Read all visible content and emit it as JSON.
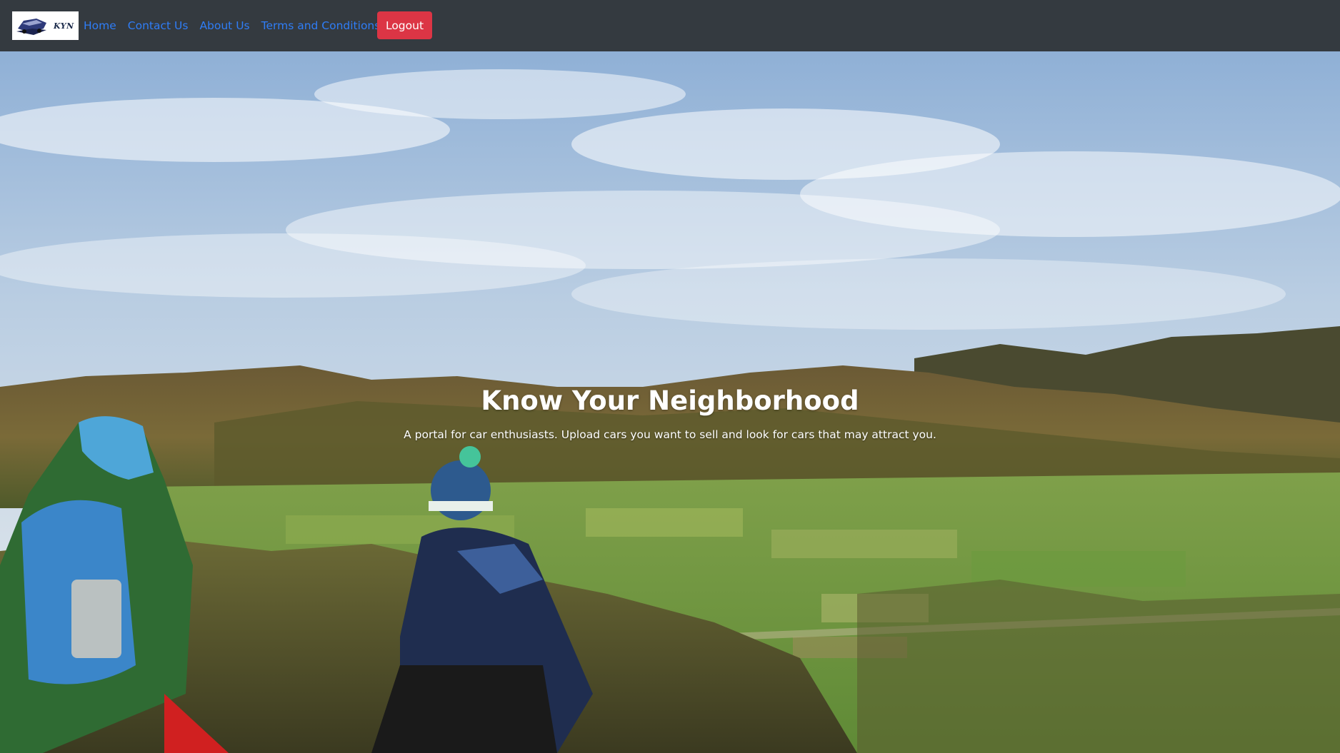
{
  "navbar": {
    "logo_icon": "kyn-car-logo",
    "logo_text": "KYN",
    "links": [
      {
        "label": "Home"
      },
      {
        "label": "Contact Us"
      },
      {
        "label": "About Us"
      },
      {
        "label": "Terms and Conditions"
      }
    ],
    "logout_label": "Logout",
    "colors": {
      "background": "#343a40",
      "link": "#2f7df6",
      "logout": "#dc3545"
    }
  },
  "hero": {
    "title": "Know Your Neighborhood",
    "subtitle": "A portal for car enthusiasts. Upload cars you want to sell and look for cars that may attract you.",
    "background_image": "two-hikers-overlooking-valley-photo"
  }
}
